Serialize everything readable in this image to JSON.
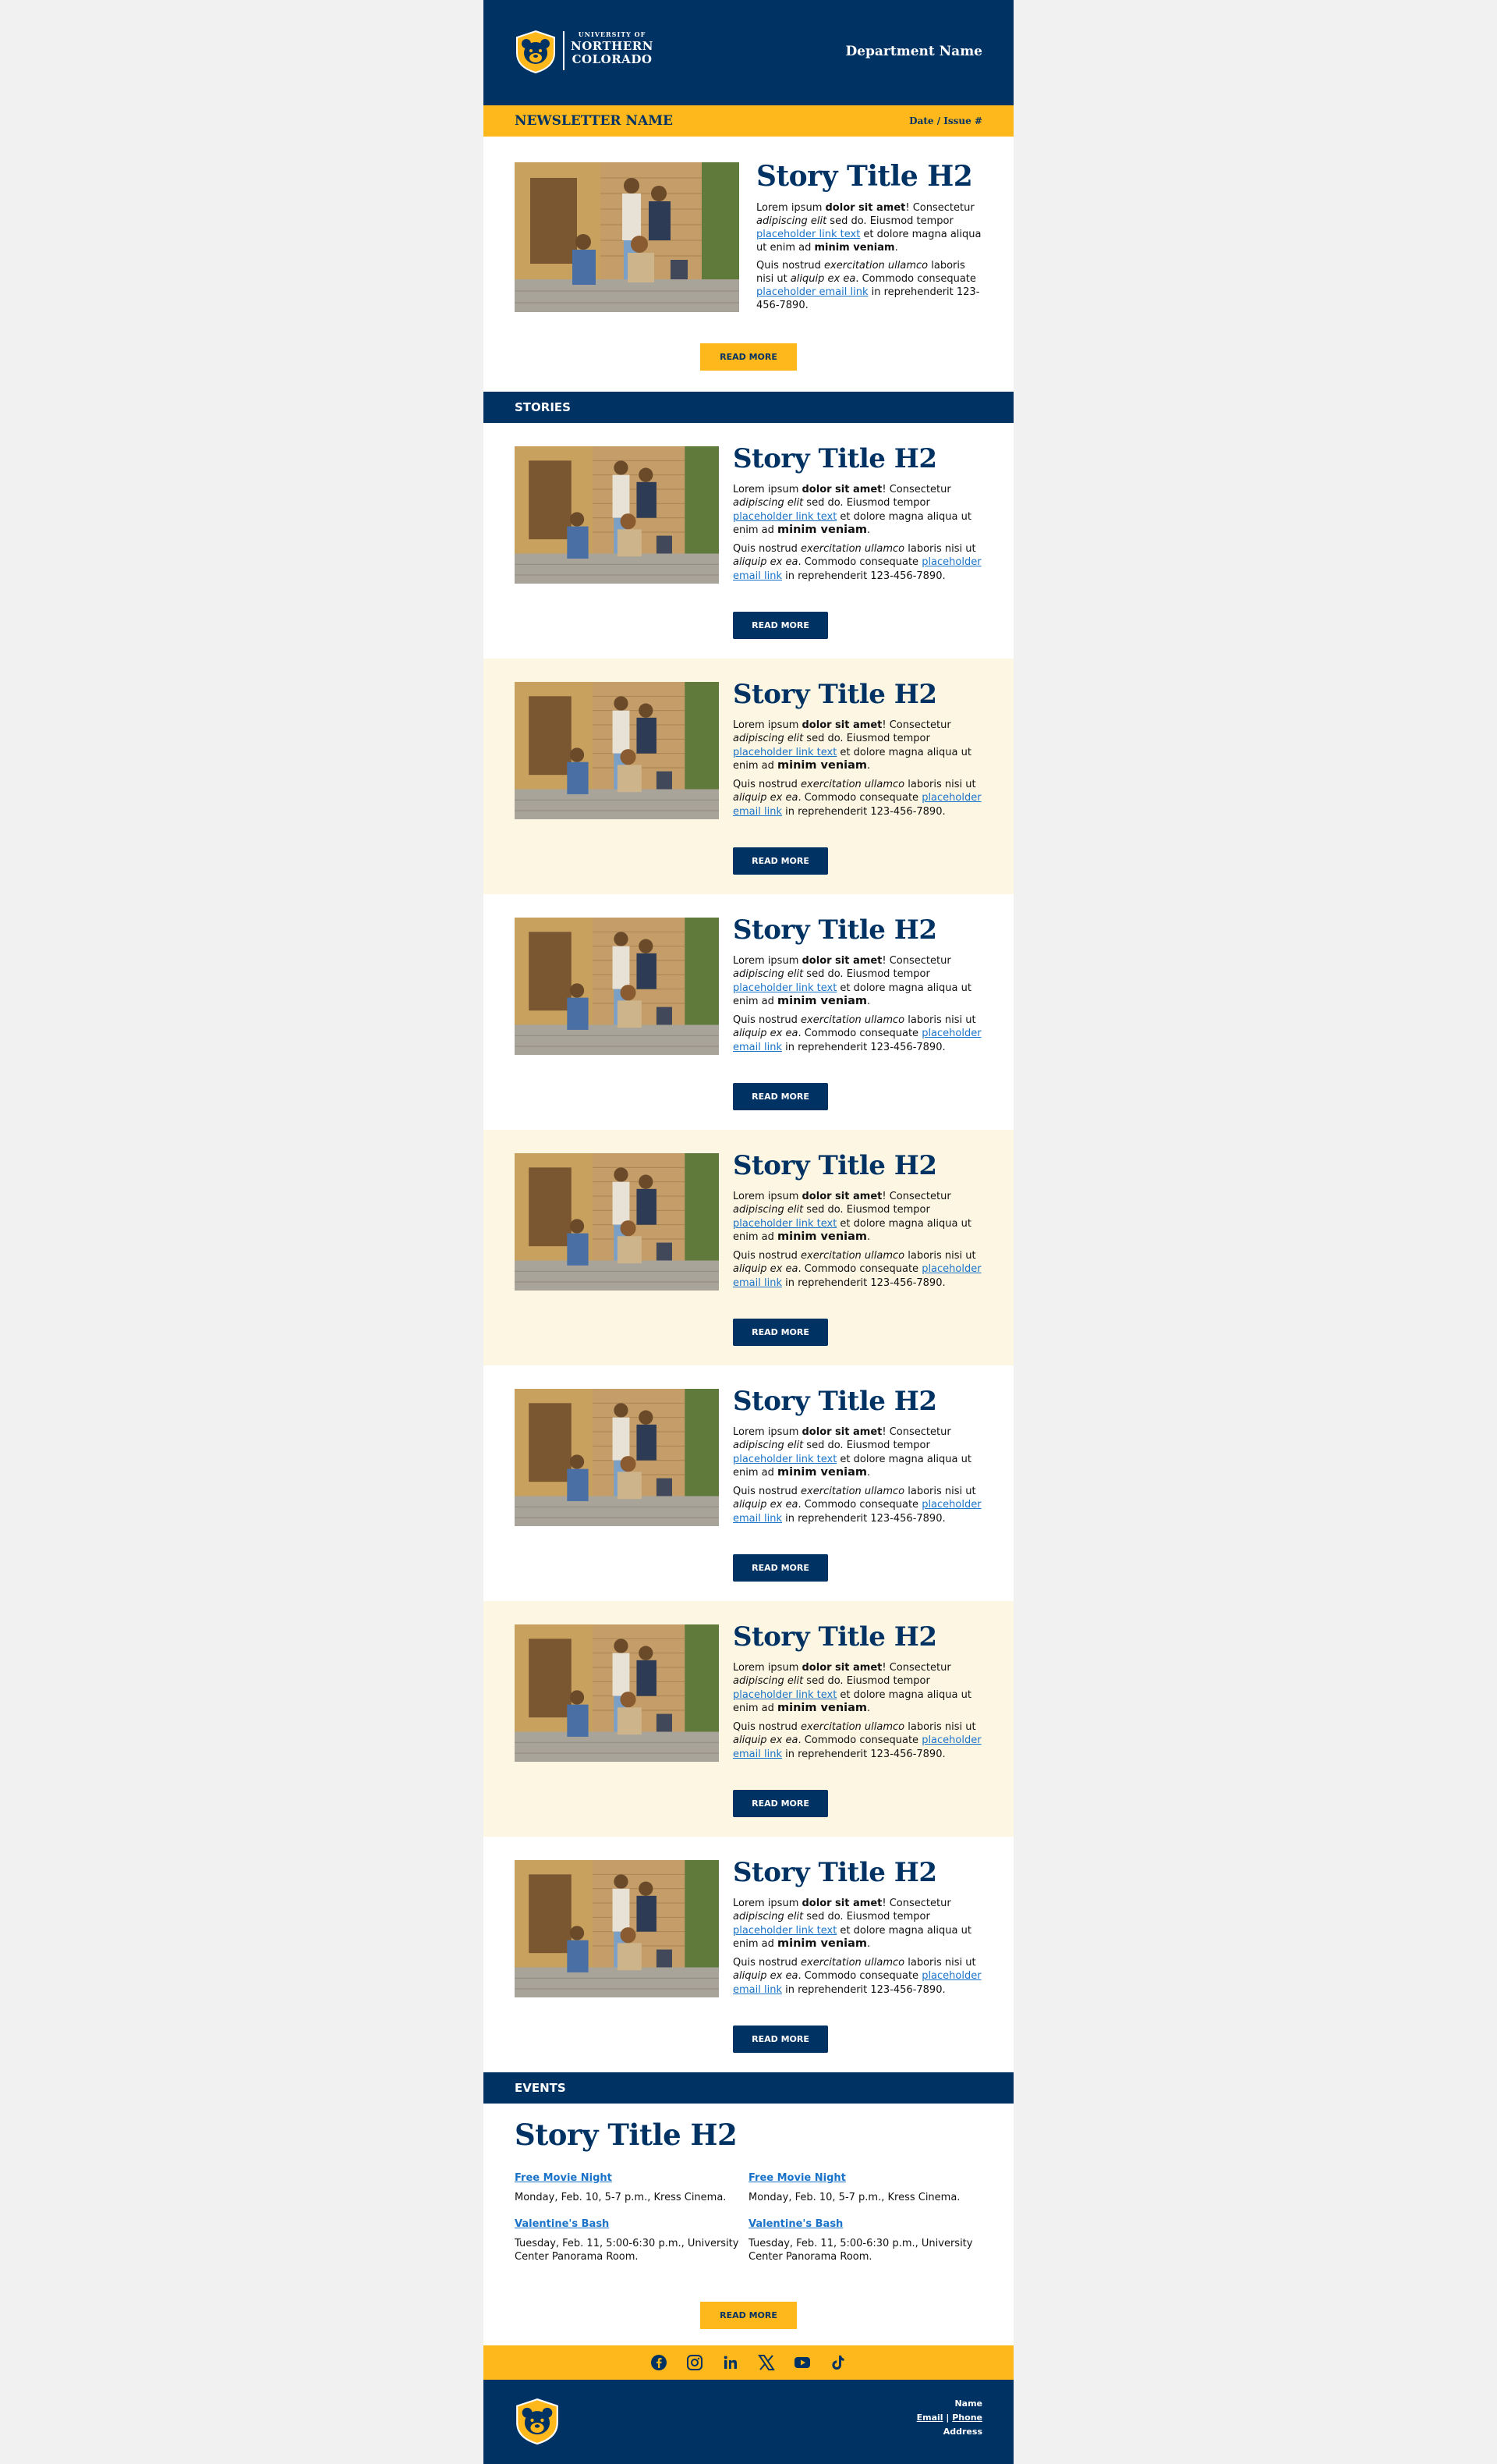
{
  "header": {
    "logo": {
      "small": "UNIVERSITY OF",
      "line1": "NORTHERN",
      "line2": "COLORADO"
    },
    "department": "Department Name"
  },
  "newsletter": {
    "name": "NEWSLETTER NAME",
    "date_issue": "Date / Issue #"
  },
  "featured": {
    "title": "Story Title H2",
    "p1": {
      "a": "Lorem ipsum ",
      "b": "dolor sit amet",
      "c": "! Consectetur ",
      "d": "adipiscing elit",
      "e": " sed do. Eiusmod tempor ",
      "link": "placeholder link text",
      "f": " et dolore magna aliqua ut enim ad ",
      "g": "minim veniam",
      "h": "."
    },
    "p2": {
      "a": "Quis nostrud ",
      "b": "exercitation ullamco",
      "c": " laboris nisi ut ",
      "d": "aliquip ex ea",
      "e": ". Commodo consequate ",
      "link": "placeholder email link",
      "f": " in reprehenderit 123-456-7890."
    },
    "button": "READ MORE"
  },
  "stories_header": "STORIES",
  "story": {
    "title": "Story Title H2",
    "p1": {
      "a": "Lorem ipsum ",
      "b": "dolor sit amet",
      "c": "! Consectetur ",
      "d": "adipiscing elit",
      "e": " sed do. Eiusmod tempor ",
      "link": "placeholder link text",
      "f": " et dolore magna aliqua ut enim ad ",
      "g": "minim veniam",
      "h": "."
    },
    "p2": {
      "a": "Quis nostrud ",
      "b": "exercitation ullamco",
      "c": " laboris nisi ut ",
      "d": "aliquip ex ea",
      "e": ". Commodo consequate ",
      "link": "placeholder email link",
      "f": " in reprehenderit 123-456-7890."
    },
    "button": "READ MORE"
  },
  "events_header": "EVENTS",
  "events": {
    "title": "Story Title H2",
    "items": [
      {
        "title": "Free Movie Night",
        "desc": "Monday, Feb. 10, 5-7 p.m., Kress Cinema."
      },
      {
        "title": "Free Movie Night",
        "desc": "Monday, Feb. 10, 5-7 p.m., Kress Cinema."
      },
      {
        "title": "Valentine's Bash",
        "desc": "Tuesday, Feb. 11, 5:00-6:30 p.m., University Center Panorama Room."
      },
      {
        "title": "Valentine's Bash",
        "desc": "Tuesday, Feb. 11, 5:00-6:30 p.m., University Center Panorama Room."
      }
    ],
    "button": "READ MORE"
  },
  "social": [
    "facebook-icon",
    "instagram-icon",
    "linkedin-icon",
    "x-icon",
    "youtube-icon",
    "tiktok-icon"
  ],
  "footer": {
    "name": "Name",
    "email": "Email",
    "sep": " | ",
    "phone": "Phone",
    "address": "Address"
  },
  "colors": {
    "navy": "#003263",
    "gold": "#ffb81c",
    "cream": "#fdf6e3",
    "link": "#1a73c8"
  }
}
